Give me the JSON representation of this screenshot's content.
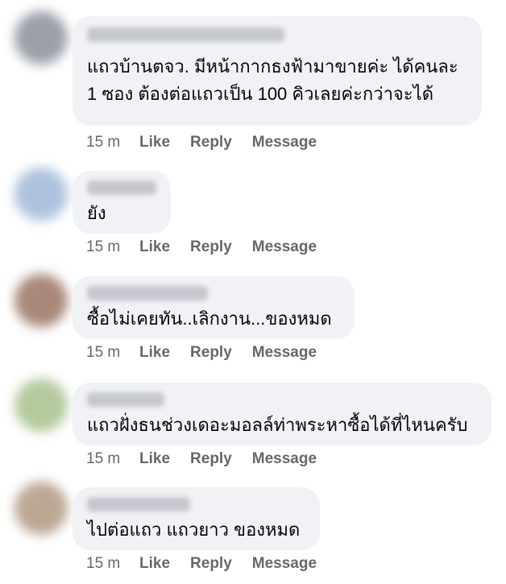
{
  "comments": [
    {
      "text_lines": [
        "แถวบ้านตจว. มีหน้ากากธงฟ้ามาขายค่ะ ได้คนละ",
        "1 ซอง ต้องต่อแถวเป็น 100 คิวเลยค่ะกว่าจะได้"
      ],
      "time": "15 m",
      "like": "Like",
      "reply": "Reply",
      "message": "Message",
      "avatar_color": "#8a8f9a"
    },
    {
      "text_lines": [
        "ยัง"
      ],
      "time": "15 m",
      "like": "Like",
      "reply": "Reply",
      "message": "Message",
      "avatar_color": "#9fb8d8"
    },
    {
      "text_lines": [
        "ซื้อไม่เคยทัน..เลิกงาน...ของหมด"
      ],
      "time": "15 m",
      "like": "Like",
      "reply": "Reply",
      "message": "Message",
      "avatar_color": "#9a7462"
    },
    {
      "text_lines": [
        "แถวฝั่งธนช่วงเดอะมอลล์ท่าพระหาซื้อได้ที่ไหนครับ"
      ],
      "time": "15 m",
      "like": "Like",
      "reply": "Reply",
      "message": "Message",
      "avatar_color": "#a8c08c"
    },
    {
      "text_lines": [
        "ไปต่อแถว แถวยาว ของหมด"
      ],
      "time": "15 m",
      "like": "Like",
      "reply": "Reply",
      "message": "Message",
      "avatar_color": "#b09880"
    }
  ]
}
